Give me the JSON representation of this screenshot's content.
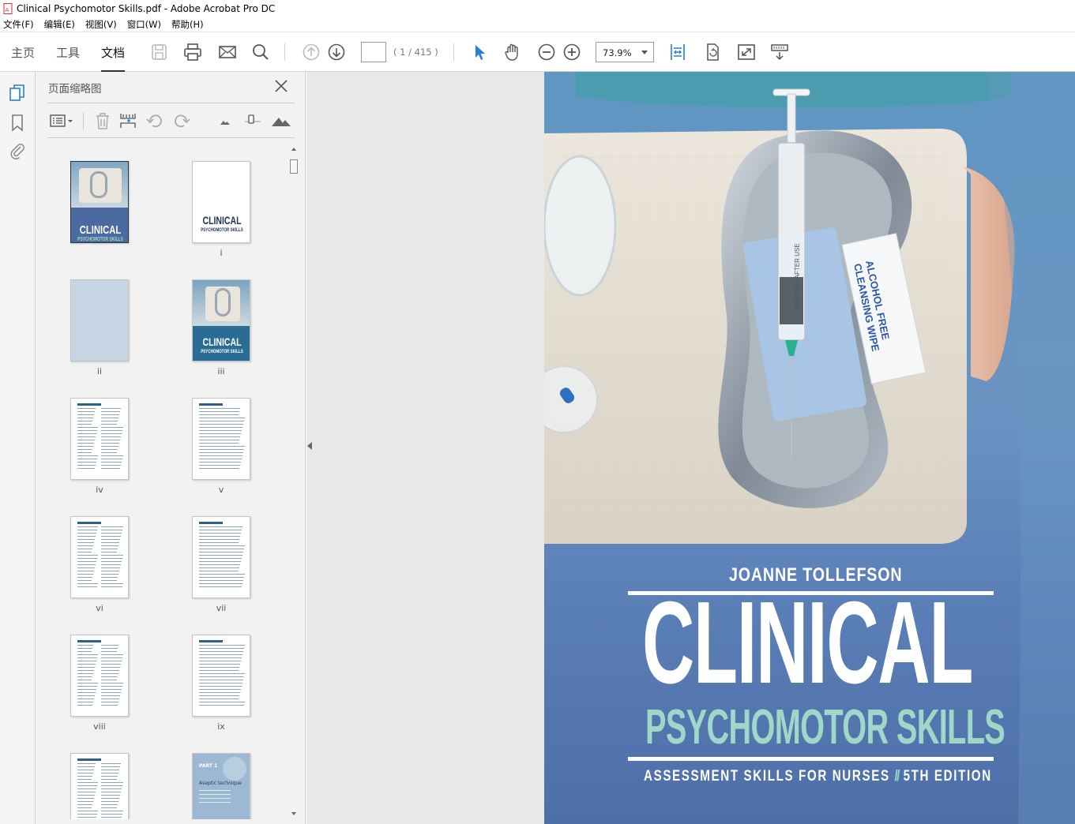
{
  "window": {
    "title": "Clinical Psychomotor Skills.pdf - Adobe Acrobat Pro DC"
  },
  "menu": [
    "文件(F)",
    "编辑(E)",
    "视图(V)",
    "窗口(W)",
    "帮助(H)"
  ],
  "tabs": [
    "主页",
    "工具",
    "文档"
  ],
  "active_tab": "文档",
  "nav": {
    "page_value": "",
    "page_count": "( 1 / 415 )"
  },
  "zoom": {
    "value": "73.9%"
  },
  "panel": {
    "title": "页面缩略图"
  },
  "thumbnails": [
    {
      "label": "",
      "cover_word": "CLINICAL",
      "cover_sub": "PSYCHOMOTOR SKILLS"
    },
    {
      "label": "i",
      "cover_word": "CLINICAL",
      "cover_sub": "PSYCHOMOTOR SKILLS"
    },
    {
      "label": "ii"
    },
    {
      "label": "iii",
      "cover_word": "CLINICAL",
      "cover_sub": "PSYCHOMOTOR SKILLS"
    },
    {
      "label": "iv"
    },
    {
      "label": "v"
    },
    {
      "label": "vi"
    },
    {
      "label": "vii"
    },
    {
      "label": "viii"
    },
    {
      "label": "ix"
    },
    {
      "label": ""
    },
    {
      "label": "",
      "part": "PART 1",
      "heading": "Aseptic technique"
    }
  ],
  "cover": {
    "author": "JOANNE TOLLEFSON",
    "title": "CLINICAL",
    "subtitle": "PSYCHOMOTOR SKILLS",
    "tagline": "ASSESSMENT SKILLS FOR NURSES",
    "separator": "//",
    "edition": "5TH EDITION",
    "wipe_text_1": "ALCOHOL FREE",
    "wipe_text_2": "CLEANSING WIPE",
    "syringe_text": "DISCARD AFTER USE"
  },
  "colors": {
    "cover_blue": "#5b7fb7",
    "subtitle_mint": "#9fd7c8",
    "tool_blue": "#2a7ed2"
  }
}
